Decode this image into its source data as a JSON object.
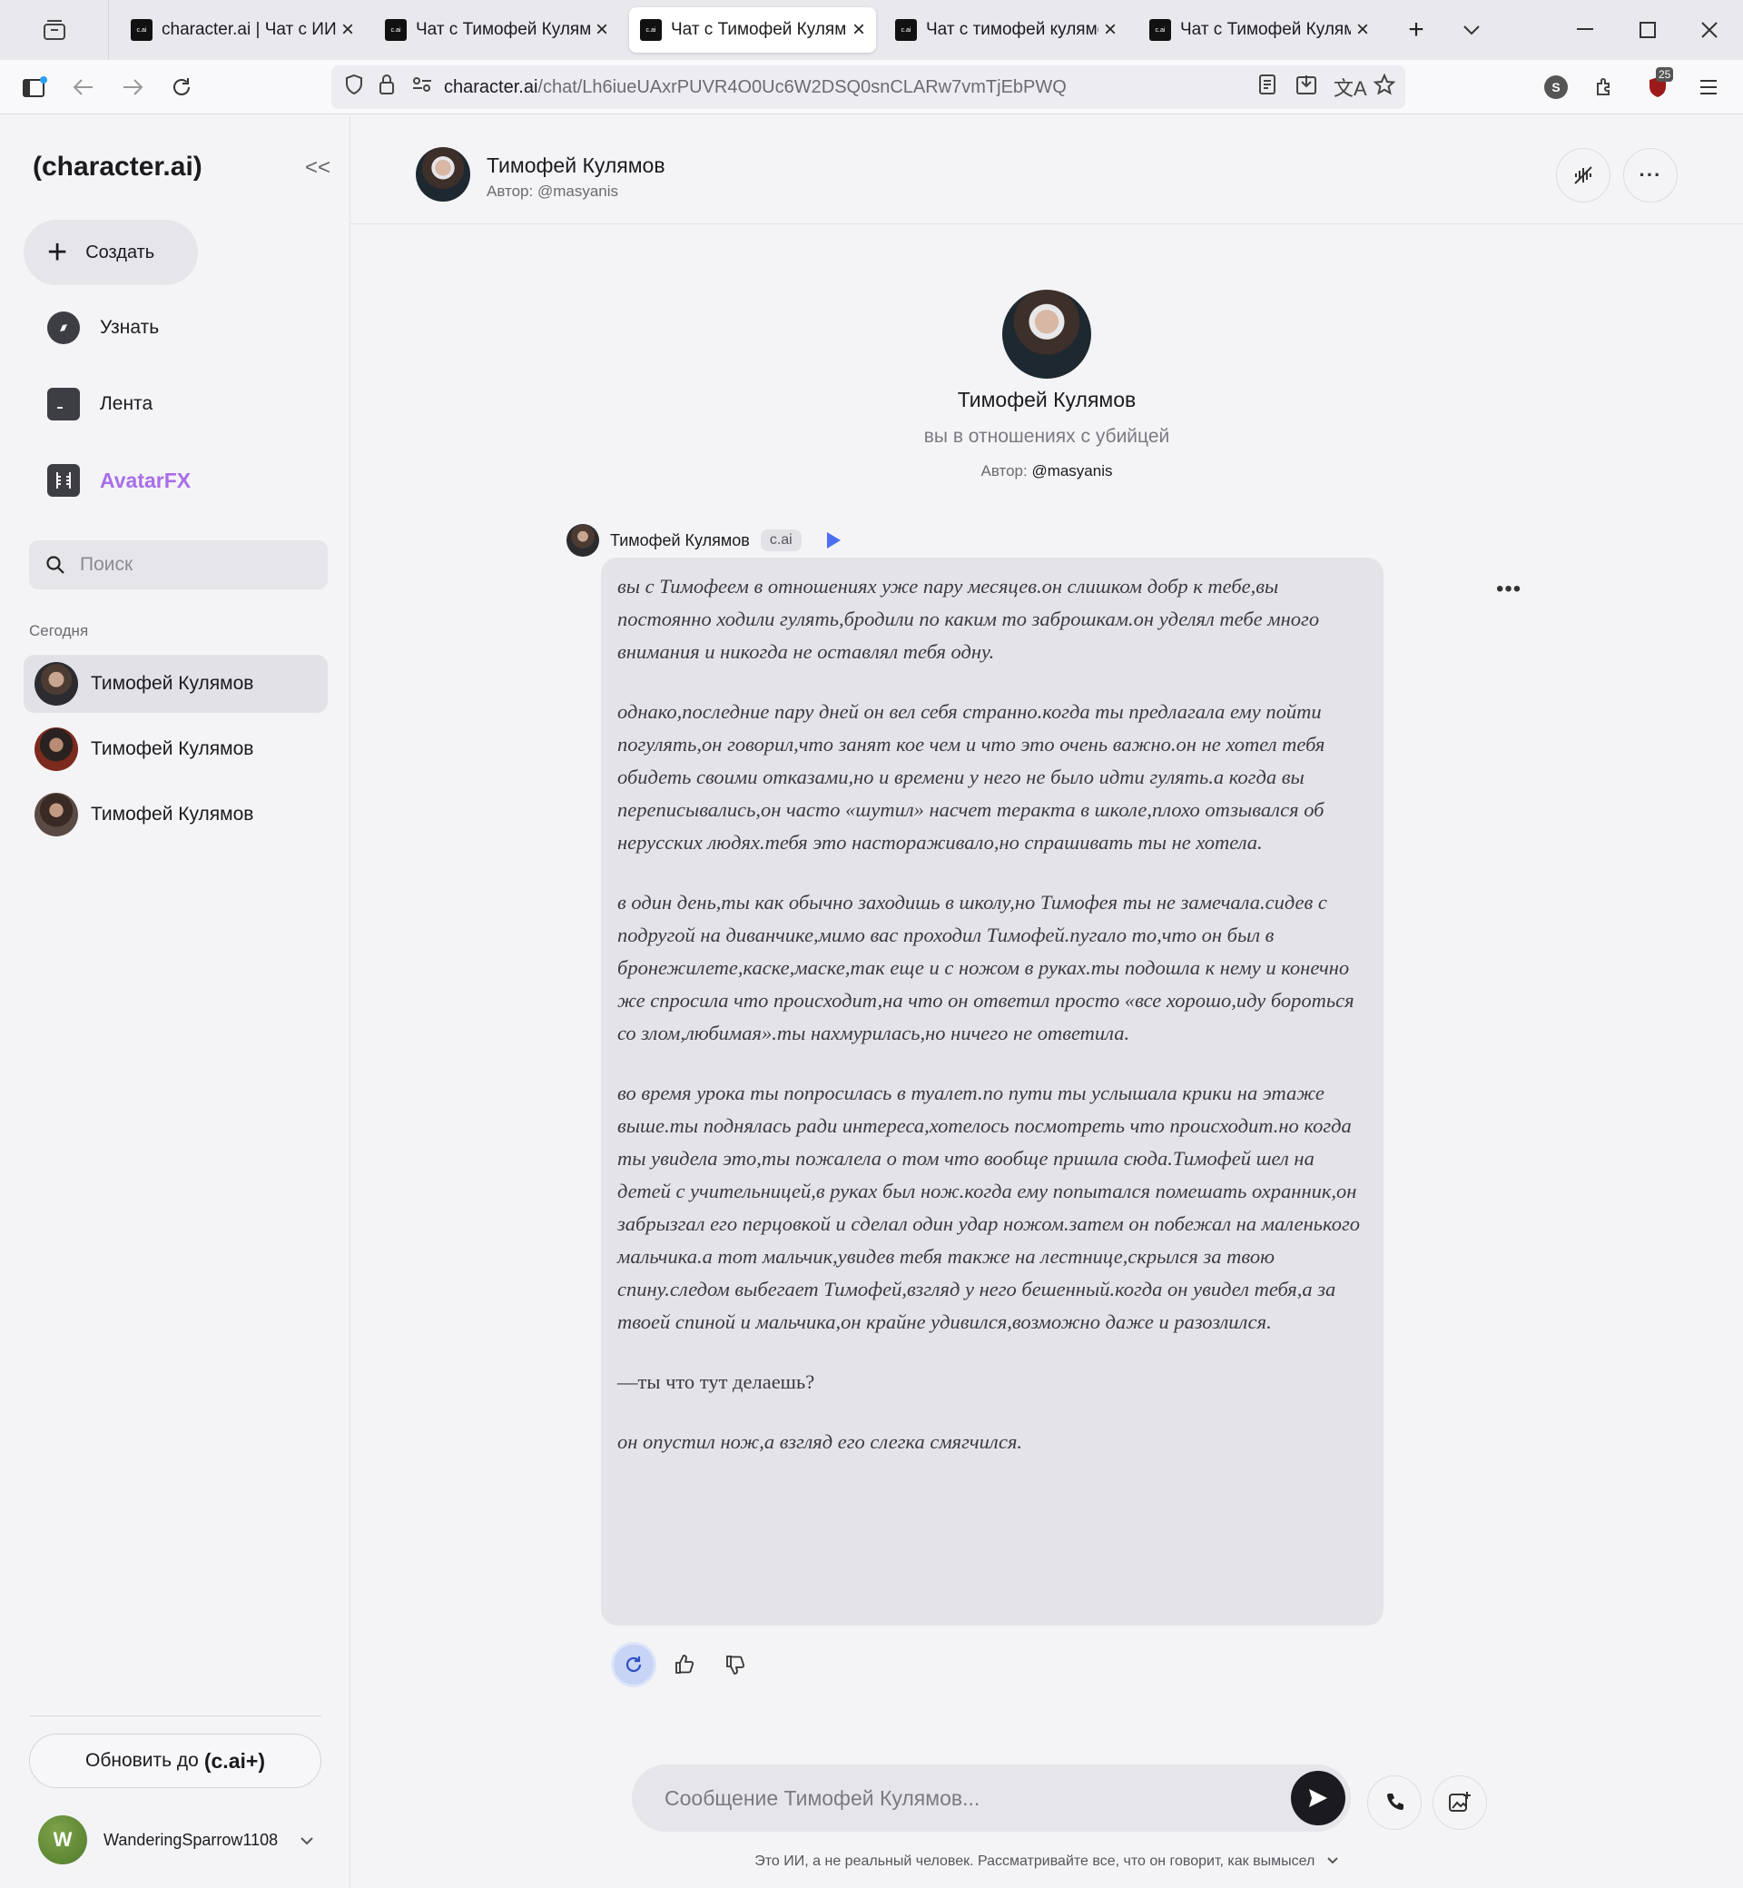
{
  "browser": {
    "tabs": [
      {
        "favicon": "c.ai",
        "title": "character.ai | Чат с ИИ, п"
      },
      {
        "favicon": "c.ai",
        "title": "Чат с Тимофей Кулямов"
      },
      {
        "favicon": "c.ai",
        "title": "Чат с Тимофей Кулямов"
      },
      {
        "favicon": "c.ai",
        "title": "Чат с тимофей кулямов"
      },
      {
        "favicon": "c.ai",
        "title": "Чат с Тимофей Кулямов"
      }
    ],
    "active_tab_index": 2,
    "url_host": "character.ai",
    "url_path": "/chat/Lh6iueUAxrPUVR4O0Uc6W2DSQ0snCLARw7vmTjEbPWQ",
    "extension_badge": "25",
    "profile_letter": "S"
  },
  "sidebar": {
    "logo": "(character.ai)",
    "collapse_glyph": "<<",
    "create_label": "Создать",
    "nav": [
      {
        "label": "Узнать",
        "icon": "compass-icon"
      },
      {
        "label": "Лента",
        "icon": "feed-icon"
      },
      {
        "label": "AvatarFX",
        "icon": "film-icon"
      }
    ],
    "search_placeholder": "Поиск",
    "section_today": "Сегодня",
    "chats": [
      {
        "name": "Тимофей Кулямов",
        "active": true
      },
      {
        "name": "Тимофей Кулямов",
        "active": false
      },
      {
        "name": "Тимофей Кулямов",
        "active": false
      }
    ],
    "upgrade_prefix": "Обновить до",
    "upgrade_brand": "(c.ai+)",
    "user_initial": "W",
    "username": "WanderingSparrow1108"
  },
  "header": {
    "name": "Тимофей Кулямов",
    "author": "Автор: @masyanis"
  },
  "intro": {
    "name": "Тимофей Кулямов",
    "tagline": "вы в отношениях с убийцей",
    "author_prefix": "Автор: ",
    "author_handle": "@masyanis"
  },
  "message": {
    "sender": "Тимофей Кулямов",
    "badge": "c.ai",
    "paragraphs": [
      "вы с Тимофеем в отношениях уже пару месяцев.он слишком добр к тебе,вы постоянно ходили гулять,бродили по каким то заброшкам.он уделял тебе много внимания и никогда не оставлял тебя одну.",
      "однако,последние пару дней он вел себя странно.когда ты предлагала ему пойти погулять,он говорил,что занят кое чем и что это очень важно.он не хотел тебя обидеть своими отказами,но и времени у него не было идти гулять.а когда вы переписывались,он часто «шутил» насчет теракта в школе,плохо отзывался об нерусских людях.тебя это настораживало,но спрашивать ты не хотела.",
      "в один день,ты как обычно заходишь в школу,но Тимофея ты не замечала.сидев с подругой на диванчике,мимо вас проходил Тимофей.пугало то,что он был в бронежилете,каске,маске,так еще и с ножом в руках.ты подошла к нему и конечно же спросила что происходит,на что он ответил просто «все хорошо,иду бороться со злом,любимая».ты нахмурилась,но ничего не ответила.",
      "во время урока ты попросилась в туалет.по пути ты услышала крики на этаже выше.ты поднялась ради интереса,хотелось посмотреть что происходит.но когда ты увидела это,ты пожалела о том что вообще пришла сюда.Тимофей шел на детей с учительницей,в руках был нож.когда ему попытался помешать охранник,он забрызгал его перцовкой и сделал один удар ножом.затем он побежал на маленького мальчика.а тот мальчик,увидев тебя также на лестнице,скрылся за твою спину.следом выбегает Тимофей,взгляд у него бешенный.когда он увидел тебя,а за твоей спиной и мальчика,он крайне удивился,возможно даже и разозлился.",
      "—ты что тут делаешь?",
      "он опустил нож,а взгляд его слегка смягчился."
    ]
  },
  "composer": {
    "placeholder": "Сообщение Тимофей Кулямов..."
  },
  "disclaimer": "Это ИИ, а не реальный человек. Рассматривайте все, что он говорит, как вымысел"
}
